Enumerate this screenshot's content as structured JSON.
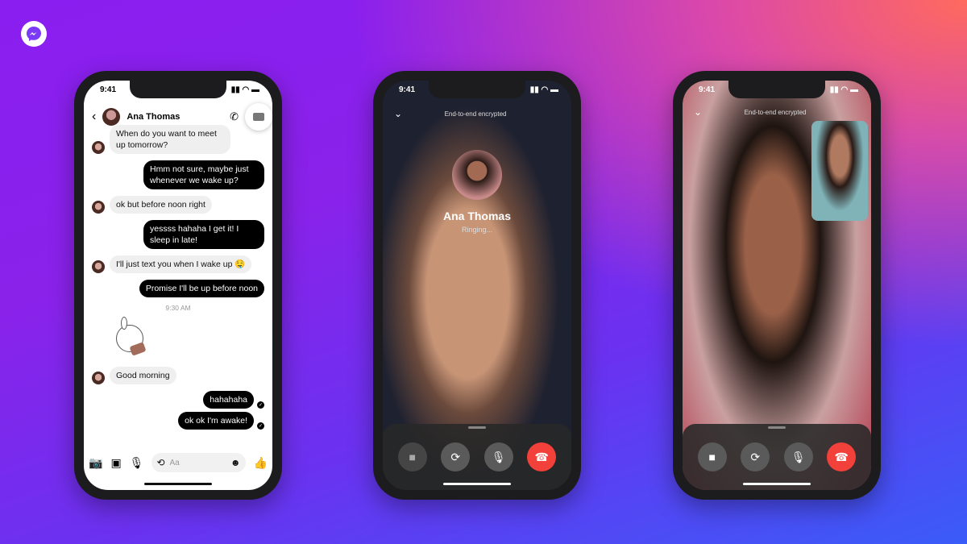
{
  "brand": {
    "logo_icon": "messenger-icon",
    "colors": {
      "bg_purple": "#8a1ef0",
      "bg_pink": "#ff6a5e",
      "bg_blue": "#3a5cf8",
      "end_call": "#f2413a"
    }
  },
  "chat_phone": {
    "time": "9:41",
    "contact": "Ana Thomas",
    "messages": [
      {
        "dir": "in",
        "text": "When do you want to meet up tomorrow?"
      },
      {
        "dir": "out",
        "text": "Hmm not sure, maybe just whenever we wake up?"
      },
      {
        "dir": "in",
        "text": "ok but before noon right"
      },
      {
        "dir": "out",
        "text": "yessss hahaha I get it! I sleep in late!"
      },
      {
        "dir": "in",
        "text": "I'll just text you when I wake up 🤤"
      },
      {
        "dir": "out",
        "text": "Promise I'll be up before noon"
      }
    ],
    "timestamp": "9:30 AM",
    "after": [
      {
        "dir": "in",
        "text": "Good morning"
      },
      {
        "dir": "out",
        "text": "hahahaha"
      },
      {
        "dir": "out",
        "text": "ok ok I'm awake!"
      }
    ],
    "composer_placeholder": "Aa"
  },
  "ringing_phone": {
    "time": "9:41",
    "encrypted": "End-to-end encrypted",
    "name": "Ana Thomas",
    "status": "Ringing..."
  },
  "call_phone": {
    "time": "9:41",
    "encrypted": "End-to-end encrypted"
  }
}
